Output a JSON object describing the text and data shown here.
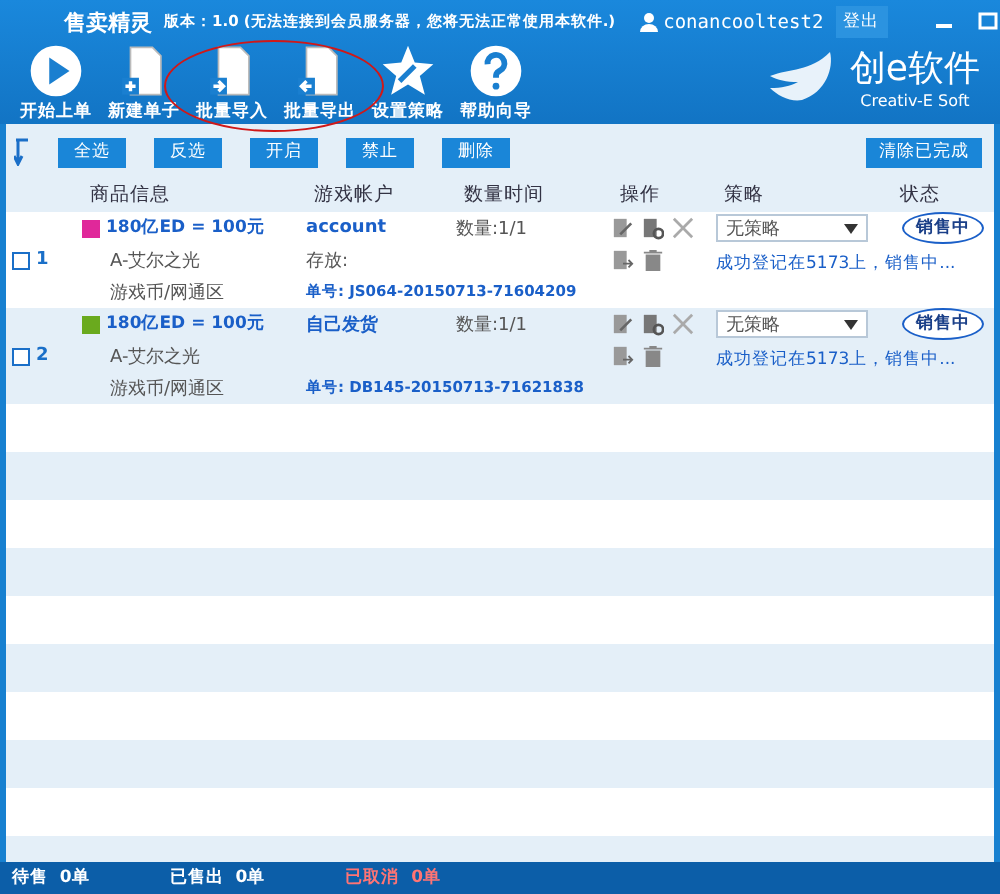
{
  "window": {
    "title": "售卖精灵",
    "version": "版本：1.0 (无法连接到会员服务器，您将无法正常使用本软件.)",
    "user": "conancooltest2",
    "logout": "登出"
  },
  "toolbar": [
    {
      "label": "开始上单",
      "kind": "play"
    },
    {
      "label": "新建单子",
      "kind": "new"
    },
    {
      "label": "批量导入",
      "kind": "import"
    },
    {
      "label": "批量导出",
      "kind": "export"
    },
    {
      "label": "设置策略",
      "kind": "star"
    },
    {
      "label": "帮助向导",
      "kind": "help"
    }
  ],
  "logo": {
    "name": "创e软件",
    "subtitle": "Creativ-E Soft"
  },
  "actions": [
    "全选",
    "反选",
    "开启",
    "禁止",
    "删除"
  ],
  "clear_button": "清除已完成",
  "table": {
    "columns": [
      "商品信息",
      "游戏帐户",
      "数量时间",
      "操作",
      "策略",
      "状态"
    ],
    "rows": [
      {
        "checked": false,
        "index": "1",
        "color": "#e0289a",
        "product": "180亿ED = 100元",
        "server": "A-艾尔之光",
        "category": "游戏币/网通区",
        "account": "account",
        "account_note": "存放:",
        "order": "单号: JS064-20150713-71604209",
        "quantity": "数量:1/1",
        "strategy": "无策略",
        "strategy_note": "成功登记在5173上，销售中...",
        "status": "销售中"
      },
      {
        "checked": false,
        "index": "2",
        "color": "#6aaa1e",
        "product": "180亿ED = 100元",
        "server": "A-艾尔之光",
        "category": "游戏币/网通区",
        "account": "自己发货",
        "order": "单号: DB145-20150713-71621838",
        "quantity": "数量:1/1",
        "strategy": "无策略",
        "strategy_note": "成功登记在5173上，销售中...",
        "status": "销售中"
      }
    ]
  },
  "status_bar": [
    {
      "label": "待售",
      "count": "0单",
      "kind": "normal"
    },
    {
      "label": "已售出",
      "count": "0单",
      "kind": "normal"
    },
    {
      "label": "已取消",
      "count": "0单",
      "kind": "alert"
    }
  ]
}
